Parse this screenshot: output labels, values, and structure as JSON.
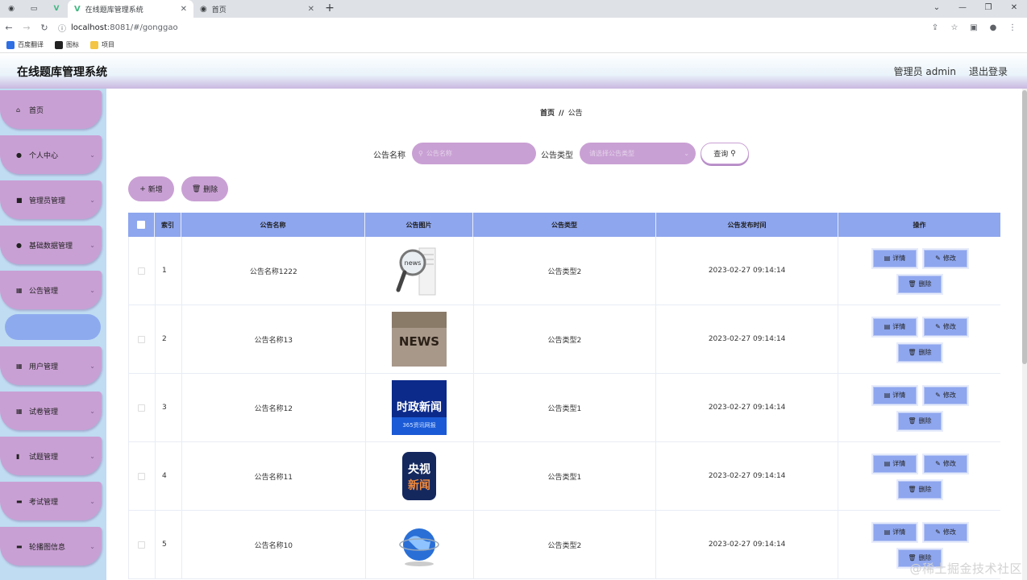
{
  "browser": {
    "tabs": [
      {
        "title": "在线题库管理系统",
        "active": true
      },
      {
        "title": "首页",
        "active": false
      }
    ],
    "url_host": "localhost",
    "url_rest": ":8081/#/gonggao",
    "bookmarks": [
      "百度翻译",
      "图标",
      "项目"
    ]
  },
  "header": {
    "title": "在线题库管理系统",
    "user": "管理员 admin",
    "logout": "退出登录"
  },
  "sidebar": {
    "items": [
      {
        "label": "首页",
        "icon": "home-icon",
        "glyph": "⌂",
        "chevron": false
      },
      {
        "label": "个人中心",
        "icon": "user-icon",
        "glyph": "●",
        "chevron": true
      },
      {
        "label": "管理员管理",
        "icon": "briefcase-icon",
        "glyph": "■",
        "chevron": true
      },
      {
        "label": "基础数据管理",
        "icon": "location-icon",
        "glyph": "●",
        "chevron": true
      },
      {
        "label": "公告管理",
        "icon": "grid-icon",
        "glyph": "▦",
        "chevron": true
      },
      {
        "label": "用户管理",
        "icon": "grid-icon",
        "glyph": "▦",
        "chevron": true
      },
      {
        "label": "试卷管理",
        "icon": "grid-icon",
        "glyph": "▦",
        "chevron": true
      },
      {
        "label": "试题管理",
        "icon": "chart-icon",
        "glyph": "▮",
        "chevron": true
      },
      {
        "label": "考试管理",
        "icon": "document-icon",
        "glyph": "▬",
        "chevron": true
      },
      {
        "label": "轮播图信息",
        "icon": "message-icon",
        "glyph": "▬",
        "chevron": true
      }
    ]
  },
  "breadcrumb": {
    "home": "首页",
    "separator": "//",
    "current": "公告"
  },
  "search": {
    "name_label": "公告名称",
    "name_placeholder": "公告名称",
    "type_label": "公告类型",
    "type_placeholder": "请选择公告类型",
    "query_label": "查询"
  },
  "actions": {
    "add": "新增",
    "delete": "删除"
  },
  "table": {
    "headers": [
      "索引",
      "公告名称",
      "公告图片",
      "公告类型",
      "公告发布时间",
      "操作"
    ],
    "rows": [
      {
        "index": "1",
        "name": "公告名称1222",
        "image": "news-magnifier",
        "type": "公告类型2",
        "time": "2023-02-27 09:14:14"
      },
      {
        "index": "2",
        "name": "公告名称13",
        "image": "news-blocks",
        "type": "公告类型2",
        "time": "2023-02-27 09:14:14"
      },
      {
        "index": "3",
        "name": "公告名称12",
        "image": "shizheng-news",
        "type": "公告类型1",
        "time": "2023-02-27 09:14:14"
      },
      {
        "index": "4",
        "name": "公告名称11",
        "image": "cctv-news",
        "type": "公告类型1",
        "time": "2023-02-27 09:14:14"
      },
      {
        "index": "5",
        "name": "公告名称10",
        "image": "globe",
        "type": "公告类型2",
        "time": "2023-02-27 09:14:14"
      }
    ],
    "row_actions": {
      "detail": "详情",
      "edit": "修改",
      "delete": "删除"
    }
  },
  "image_text": {
    "news": "NEWS",
    "shizheng": "时政新闻",
    "shizheng_sub": "365资讯网报",
    "cctv_top": "央视",
    "cctv_bottom": "新闻"
  },
  "watermark": "@稀土掘金技术社区",
  "colors": {
    "accent_purple": "#c9a0d4",
    "accent_blue": "#8ea6ee",
    "sidebar_bg": "#bfdcf2"
  }
}
